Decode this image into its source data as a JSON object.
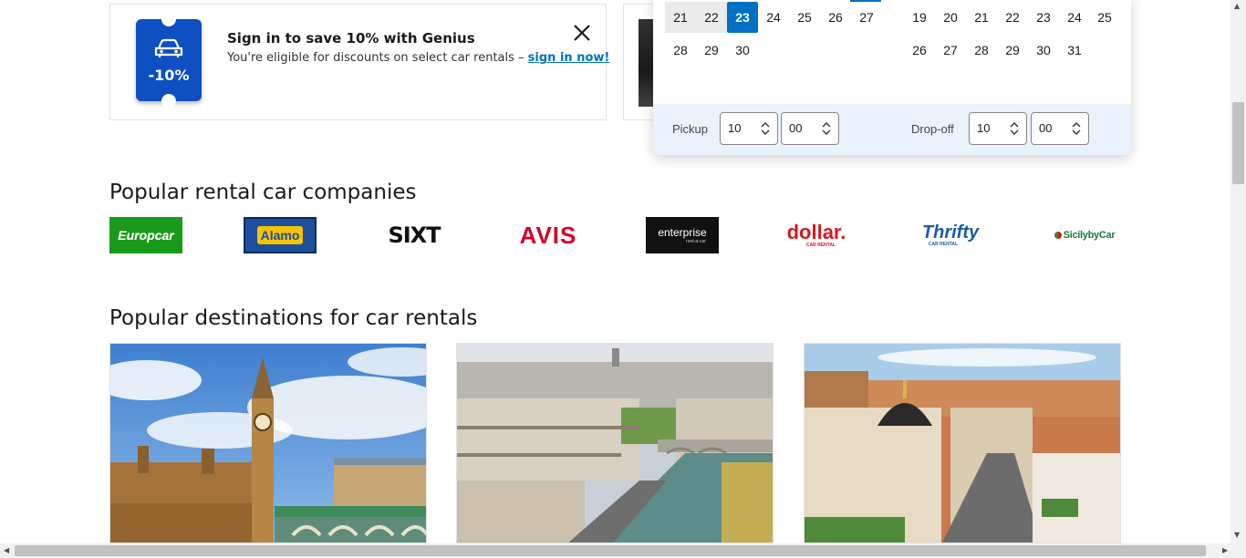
{
  "genius": {
    "badge": "-10%",
    "title": "Sign in to save 10% with Genius",
    "subtitle": "You're eligible for discounts on select car rentals – ",
    "link": "sign in now!"
  },
  "calendar": {
    "left_row1": [
      "21",
      "22",
      "23",
      "24",
      "25",
      "26",
      "27"
    ],
    "left_row2": [
      "28",
      "29",
      "30"
    ],
    "right_row1": [
      "19",
      "20",
      "21",
      "22",
      "23",
      "24",
      "25"
    ],
    "right_row2": [
      "26",
      "27",
      "28",
      "29",
      "30",
      "31"
    ],
    "selected_day": "23",
    "pickup_label": "Pickup",
    "pickup_hour": "10",
    "pickup_minute": "00",
    "dropoff_label": "Drop-off",
    "dropoff_hour": "10",
    "dropoff_minute": "00"
  },
  "companies": {
    "title": "Popular rental car companies",
    "logos": [
      "Europcar",
      "Alamo",
      "SIXT",
      "AVIS",
      "enterprise",
      "dollar.",
      "Thrifty",
      "SicilybyCar"
    ],
    "logo_subs": {
      "enterprise": "rent-a-car",
      "dollar": "CAR RENTAL",
      "thrifty": "CAR RENTAL"
    }
  },
  "destinations": {
    "title": "Popular destinations for car rentals"
  },
  "colors": {
    "accent": "#0071c2",
    "genius_blue": "#0e4fc2",
    "europcar_green": "#1a9a1a",
    "alamo_blue": "#1c4f9c",
    "avis_red": "#d4002a",
    "dollar_red": "#d71920",
    "thrifty_blue": "#1a5bab"
  }
}
